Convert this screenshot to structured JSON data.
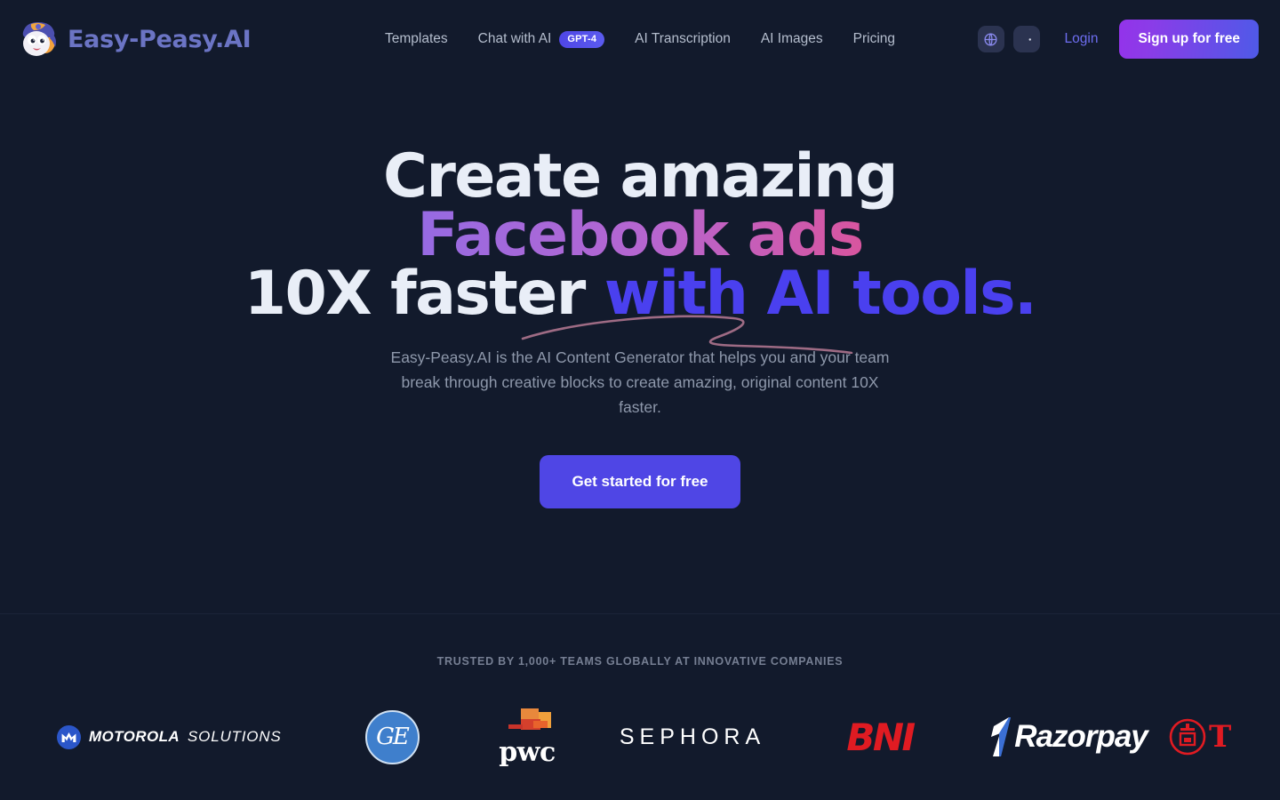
{
  "brand": {
    "name": "Easy-Peasy.AI",
    "logo_icon": "mascot-icon"
  },
  "nav": {
    "items": [
      {
        "label": "Templates",
        "badge": null
      },
      {
        "label": "Chat with AI",
        "badge": "GPT-4"
      },
      {
        "label": "AI Transcription",
        "badge": null
      },
      {
        "label": "AI Images",
        "badge": null
      },
      {
        "label": "Pricing",
        "badge": null
      }
    ],
    "language_icon": "globe-icon",
    "theme_icon": "moon-icon",
    "login_label": "Login",
    "signup_label": "Sign up for free"
  },
  "hero": {
    "headline_line1": "Create amazing",
    "headline_line2": "Facebook ads",
    "headline_line3_plain": "10X faster ",
    "headline_line3_accent": "with AI tools.",
    "subtitle": "Easy-Peasy.AI is the AI Content Generator that helps you and your team break through creative blocks to create amazing, original content 10X faster.",
    "cta_label": "Get started for free"
  },
  "trusted": {
    "label": "TRUSTED BY 1,000+ TEAMS GLOBALLY AT INNOVATIVE COMPANIES",
    "logos": [
      {
        "name": "Motorola Solutions",
        "primary": "MOTOROLA",
        "secondary": "SOLUTIONS"
      },
      {
        "name": "GE",
        "primary": "GE",
        "secondary": ""
      },
      {
        "name": "pwc",
        "primary": "pwc",
        "secondary": ""
      },
      {
        "name": "Sephora",
        "primary": "SEPHORA",
        "secondary": ""
      },
      {
        "name": "BNI",
        "primary": "BNI",
        "secondary": ""
      },
      {
        "name": "Razorpay",
        "primary": "Razorpay",
        "secondary": ""
      },
      {
        "name": "partial-red-logo",
        "primary": "T",
        "secondary": ""
      }
    ]
  },
  "colors": {
    "background": "#121a2c",
    "accent_purple": "#4f46e5",
    "accent_blue": "#4a40ef",
    "brand_text": "#6b74c4",
    "login_link": "#6d6df0",
    "squiggle": "#9e6b84",
    "muted_text": "#8e98ab"
  }
}
